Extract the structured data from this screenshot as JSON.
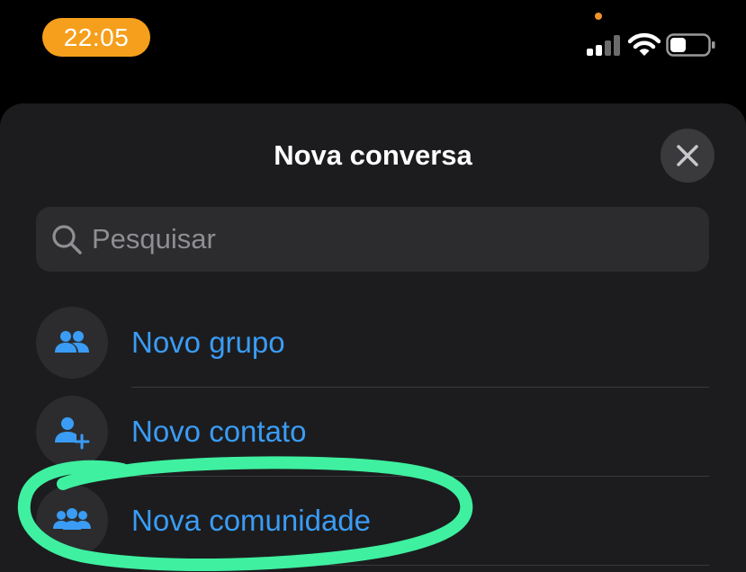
{
  "status_bar": {
    "time": "22:05",
    "time_pill_color": "#f59f1c",
    "icons": [
      "signal-icon",
      "wifi-icon",
      "battery-icon"
    ]
  },
  "sheet": {
    "title": "Nova conversa",
    "close_icon": "close-icon"
  },
  "search": {
    "placeholder": "Pesquisar",
    "value": "",
    "icon": "search-icon"
  },
  "options": [
    {
      "label": "Novo grupo",
      "icon": "group-icon"
    },
    {
      "label": "Novo contato",
      "icon": "add-contact-icon"
    },
    {
      "label": "Nova comunidade",
      "icon": "community-icon"
    }
  ],
  "colors": {
    "accent": "#3a9cf4",
    "sheet_background": "#1c1c1e",
    "annotation": "#3ef0a0"
  }
}
